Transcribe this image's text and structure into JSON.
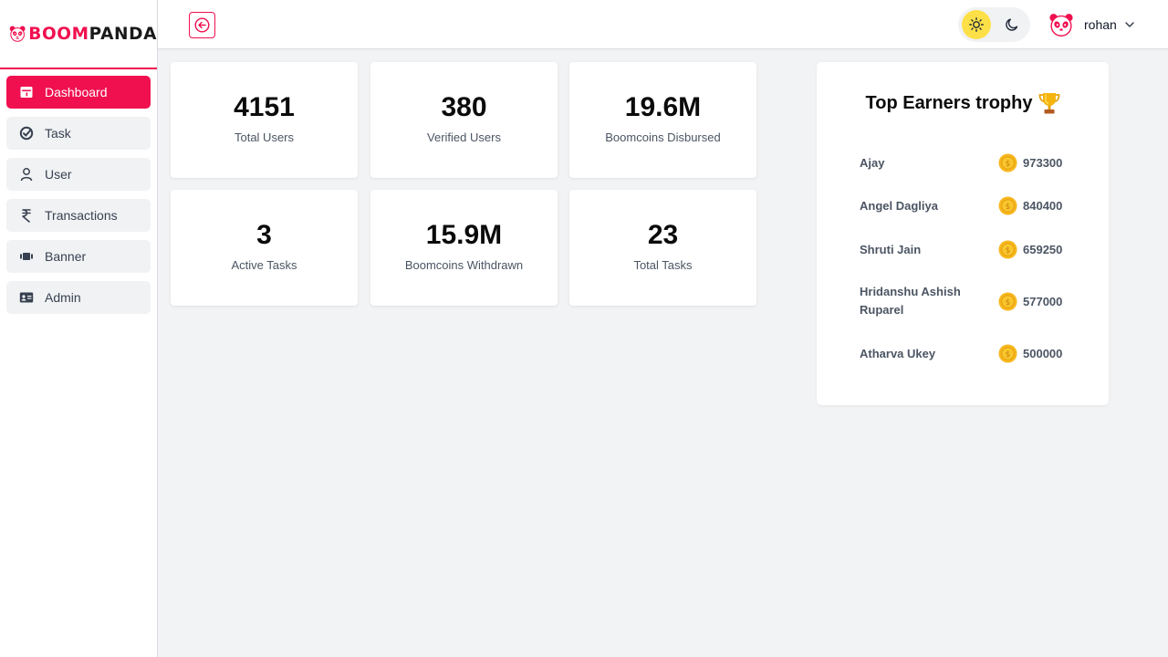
{
  "brand": {
    "part1": "BOOM",
    "part2": "PANDA"
  },
  "colors": {
    "accent": "#f0104f",
    "sun_bg": "#fde047",
    "coin": "#f7b71d"
  },
  "sidebar": {
    "items": [
      {
        "label": "Dashboard",
        "icon": "dashboard-icon",
        "active": true
      },
      {
        "label": "Task",
        "icon": "task-check-icon"
      },
      {
        "label": "User",
        "icon": "user-icon"
      },
      {
        "label": "Transactions",
        "icon": "rupee-icon"
      },
      {
        "label": "Banner",
        "icon": "banner-icon"
      },
      {
        "label": "Admin",
        "icon": "id-card-icon"
      }
    ]
  },
  "header": {
    "back_icon": "arrow-left-icon",
    "theme": {
      "light_icon": "sun-icon",
      "dark_icon": "moon-icon",
      "selected": "light"
    },
    "user": {
      "name": "rohan",
      "menu_icon": "chevron-down-icon"
    }
  },
  "stats": [
    {
      "value": "4151",
      "label": "Total Users"
    },
    {
      "value": "380",
      "label": "Verified Users"
    },
    {
      "value": "19.6M",
      "label": "Boomcoins Disbursed"
    },
    {
      "value": "3",
      "label": "Active Tasks"
    },
    {
      "value": "15.9M",
      "label": "Boomcoins Withdrawn"
    },
    {
      "value": "23",
      "label": "Total Tasks"
    }
  ],
  "top_earners": {
    "title": "Top Earners trophy",
    "entries": [
      {
        "name": "Ajay",
        "amount": "973300"
      },
      {
        "name": "Angel Dagliya",
        "amount": "840400"
      },
      {
        "name": "Shruti Jain",
        "amount": "659250"
      },
      {
        "name": "Hridanshu Ashish Ruparel",
        "amount": "577000"
      },
      {
        "name": "Atharva Ukey",
        "amount": "500000"
      }
    ]
  }
}
